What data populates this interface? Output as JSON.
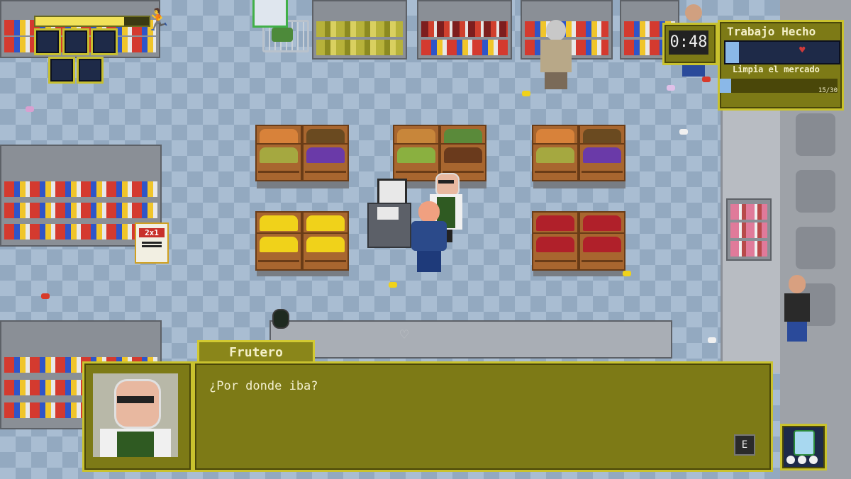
{
  "hud": {
    "energy_fraction": 0.78,
    "timer": "0:48",
    "job_title": "Trabajo Hecho",
    "task_label": "Limpia el mercado",
    "task_progress": "15/30",
    "task_fraction": 0.5,
    "job_fraction": 0.12
  },
  "dialog": {
    "speaker": "Frutero",
    "text": "¿Por donde iba?",
    "continue_key": "E"
  },
  "sign": {
    "text": "2x1"
  },
  "icons": {
    "runner": "running-man-icon",
    "tool": "spray-bottle-icon",
    "dirt": "heart-icon"
  },
  "colors": {
    "accent_yellow": "#c9c22e",
    "panel_olive": "#7d7a16",
    "slot_navy": "#1e2a48"
  }
}
